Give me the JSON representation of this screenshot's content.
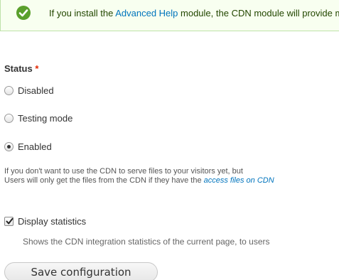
{
  "message": {
    "prefix": "If you install the ",
    "link": "Advanced Help",
    "suffix": " module, the CDN module will provide more and better help."
  },
  "status": {
    "label": "Status",
    "required_marker": "*",
    "options": [
      {
        "label": "Disabled",
        "checked": false
      },
      {
        "label": "Testing mode",
        "checked": false
      },
      {
        "label": "Enabled",
        "checked": true
      }
    ],
    "description_line1": "If you don't want to use the CDN to serve files to your visitors yet, but",
    "description_line2_prefix": "Users will only get the files from the CDN if they have the ",
    "description_line2_link": "access files on CDN"
  },
  "stats": {
    "label": "Display statistics",
    "checked": true,
    "description": "Shows the CDN integration statistics of the current page, to users"
  },
  "actions": {
    "save_label": "Save configuration"
  },
  "colors": {
    "success": "#5aa02c",
    "link": "#0074bd",
    "required": "#e32700"
  }
}
